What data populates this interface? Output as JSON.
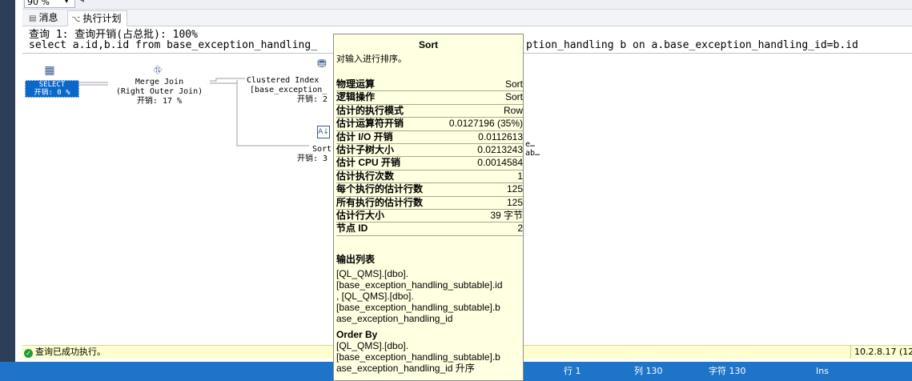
{
  "zoom": {
    "value": "90 %"
  },
  "tabs": [
    {
      "label": "消息"
    },
    {
      "label": "执行计划"
    }
  ],
  "query": {
    "header": "查询 1: 查询开销(占总批): 100%",
    "sql_left": "select a.id,b.id from base_exception_handling_",
    "sql_right": "ption_handling b on a.base_exception_handling_id=b.id"
  },
  "plan": {
    "select_node": {
      "line1": "SELECT",
      "line2": "开销: 0 %"
    },
    "merge_join": {
      "line1": "Merge Join",
      "line2": "(Right Outer Join)",
      "line3": "开销: 17 %"
    },
    "clustered_index": {
      "line1": "Clustered Index",
      "line2": "[base_exception_",
      "line3": "开销: 2"
    },
    "sort_node": {
      "line1": "Sort",
      "line2": "开销: 3"
    },
    "right_fragment1": "e…",
    "right_fragment2": "ab…"
  },
  "tooltip": {
    "title": "Sort",
    "description": "对输入进行排序。",
    "properties": [
      {
        "key": "物理运算",
        "value": "Sort"
      },
      {
        "key": "逻辑操作",
        "value": "Sort"
      },
      {
        "key": "估计的执行模式",
        "value": "Row"
      },
      {
        "key": "估计运算符开销",
        "value": "0.0127196 (35%)"
      },
      {
        "key": "估计 I/O 开销",
        "value": "0.0112613"
      },
      {
        "key": "估计子树大小",
        "value": "0.0213243"
      },
      {
        "key": "估计 CPU 开销",
        "value": "0.0014584"
      },
      {
        "key": "估计执行次数",
        "value": "1"
      },
      {
        "key": "每个执行的估计行数",
        "value": "125"
      },
      {
        "key": "所有执行的估计行数",
        "value": "125"
      },
      {
        "key": "估计行大小",
        "value": "39 字节"
      },
      {
        "key": "节点 ID",
        "value": "2"
      }
    ],
    "output_list": {
      "heading": "输出列表",
      "lines": [
        "[QL_QMS].[dbo].",
        "[base_exception_handling_subtable].id",
        ", [QL_QMS].[dbo].",
        "[base_exception_handling_subtable].b",
        "ase_exception_handling_id"
      ]
    },
    "order_by": {
      "heading": "Order By",
      "lines": [
        "[QL_QMS].[dbo].",
        "[base_exception_handling_subtable].b",
        "ase_exception_handling_id 升序"
      ]
    }
  },
  "status_bar": {
    "message": "查询已成功执行。",
    "server_version": "10.2.8.17 (12"
  },
  "app_status": {
    "line": "行 1",
    "col": "列 130",
    "char": "字符 130",
    "mode": "Ins"
  }
}
